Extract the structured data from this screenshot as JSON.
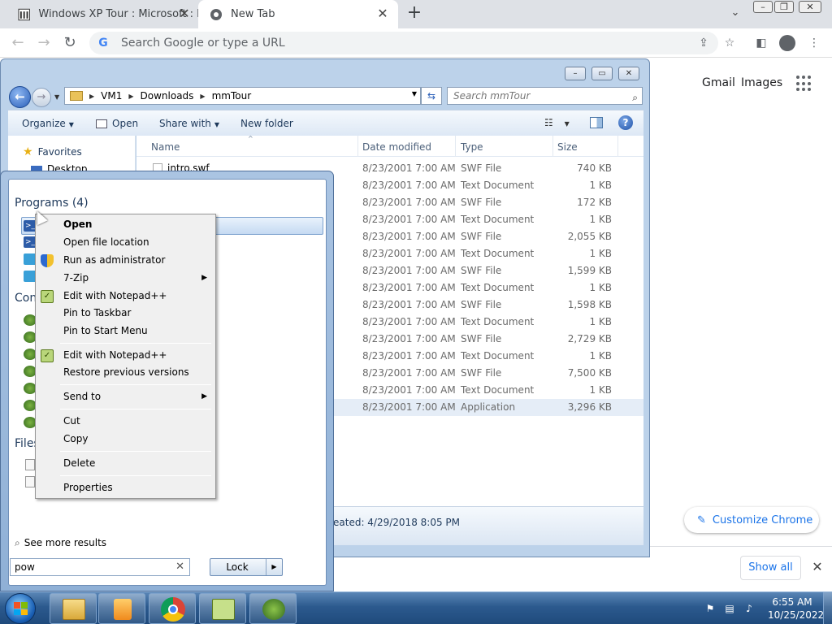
{
  "chrome": {
    "tabs": [
      {
        "title": "Windows XP Tour : Microsoft : Fr"
      },
      {
        "title": "New Tab"
      }
    ],
    "omnibox_placeholder": "Search Google or type a URL",
    "ntp": {
      "gmail": "Gmail",
      "images": "Images",
      "customize": "Customize Chrome"
    },
    "download_bar": {
      "show_all": "Show all"
    }
  },
  "explorer": {
    "breadcrumbs": [
      "VM1",
      "Downloads",
      "mmTour"
    ],
    "search_placeholder": "Search mmTour",
    "commands": {
      "organize": "Organize",
      "open": "Open",
      "share_with": "Share with",
      "new_folder": "New folder"
    },
    "nav": {
      "favorites": "Favorites",
      "desktop": "Desktop"
    },
    "columns": {
      "name": "Name",
      "date": "Date modified",
      "type": "Type",
      "size": "Size"
    },
    "first_file_name": "intro.swf",
    "files": [
      {
        "date": "8/23/2001 7:00 AM",
        "type": "SWF File",
        "size": "740 KB"
      },
      {
        "date": "8/23/2001 7:00 AM",
        "type": "Text Document",
        "size": "1 KB"
      },
      {
        "date": "8/23/2001 7:00 AM",
        "type": "SWF File",
        "size": "172 KB"
      },
      {
        "date": "8/23/2001 7:00 AM",
        "type": "Text Document",
        "size": "1 KB"
      },
      {
        "date": "8/23/2001 7:00 AM",
        "type": "SWF File",
        "size": "2,055 KB"
      },
      {
        "date": "8/23/2001 7:00 AM",
        "type": "Text Document",
        "size": "1 KB"
      },
      {
        "date": "8/23/2001 7:00 AM",
        "type": "SWF File",
        "size": "1,599 KB"
      },
      {
        "date": "8/23/2001 7:00 AM",
        "type": "Text Document",
        "size": "1 KB"
      },
      {
        "date": "8/23/2001 7:00 AM",
        "type": "SWF File",
        "size": "1,598 KB"
      },
      {
        "date": "8/23/2001 7:00 AM",
        "type": "Text Document",
        "size": "1 KB"
      },
      {
        "date": "8/23/2001 7:00 AM",
        "type": "SWF File",
        "size": "2,729 KB"
      },
      {
        "date": "8/23/2001 7:00 AM",
        "type": "Text Document",
        "size": "1 KB"
      },
      {
        "date": "8/23/2001 7:00 AM",
        "type": "SWF File",
        "size": "7,500 KB"
      },
      {
        "date": "8/23/2001 7:00 AM",
        "type": "Text Document",
        "size": "1 KB"
      },
      {
        "date": "8/23/2001 7:00 AM",
        "type": "Application",
        "size": "3,296 KB"
      }
    ],
    "details_created": "eated: 4/29/2018 8:05 PM"
  },
  "start_menu": {
    "programs_header": "Programs (4)",
    "control_header": "Con",
    "files_header": "Files",
    "see_more": "See more results",
    "search_value": "pow",
    "lock_label": "Lock"
  },
  "context_menu": {
    "items": [
      "Open",
      "Open file location",
      "Run as administrator",
      "7-Zip",
      "Edit with Notepad++",
      "Pin to Taskbar",
      "Pin to Start Menu",
      "Edit with Notepad++",
      "Restore previous versions",
      "Send to",
      "Cut",
      "Copy",
      "Delete",
      "Properties"
    ]
  },
  "taskbar": {
    "time": "6:55 AM",
    "date": "10/25/2022"
  },
  "colors": {
    "chrome_tabstrip": "#dee1e6",
    "chrome_link": "#1a73e8",
    "explorer_frame": "#bcd2ea",
    "taskbar": "#2c5a8e"
  }
}
